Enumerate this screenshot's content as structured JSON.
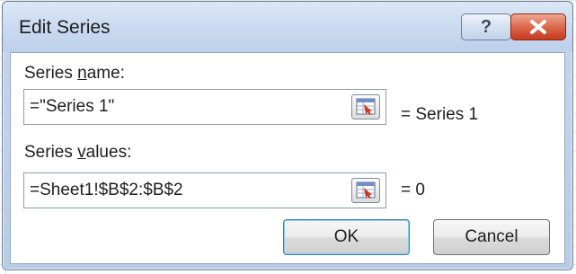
{
  "dialog": {
    "title": "Edit Series",
    "help_label": "?",
    "close_icon": "close-x-icon"
  },
  "series_name": {
    "label_before": "Series ",
    "label_accel": "n",
    "label_after": "ame:",
    "value": "=\"Series 1\"",
    "result": "= Series 1"
  },
  "series_values": {
    "label_before": "Series ",
    "label_accel": "v",
    "label_after": "alues:",
    "value": "=Sheet1!$B$2:$B$2",
    "result": "= 0"
  },
  "buttons": {
    "ok": "OK",
    "cancel": "Cancel"
  },
  "colors": {
    "close_red": "#c7391c",
    "frame_blue": "#bdd0ea",
    "default_button_border": "#3c7fb1"
  }
}
